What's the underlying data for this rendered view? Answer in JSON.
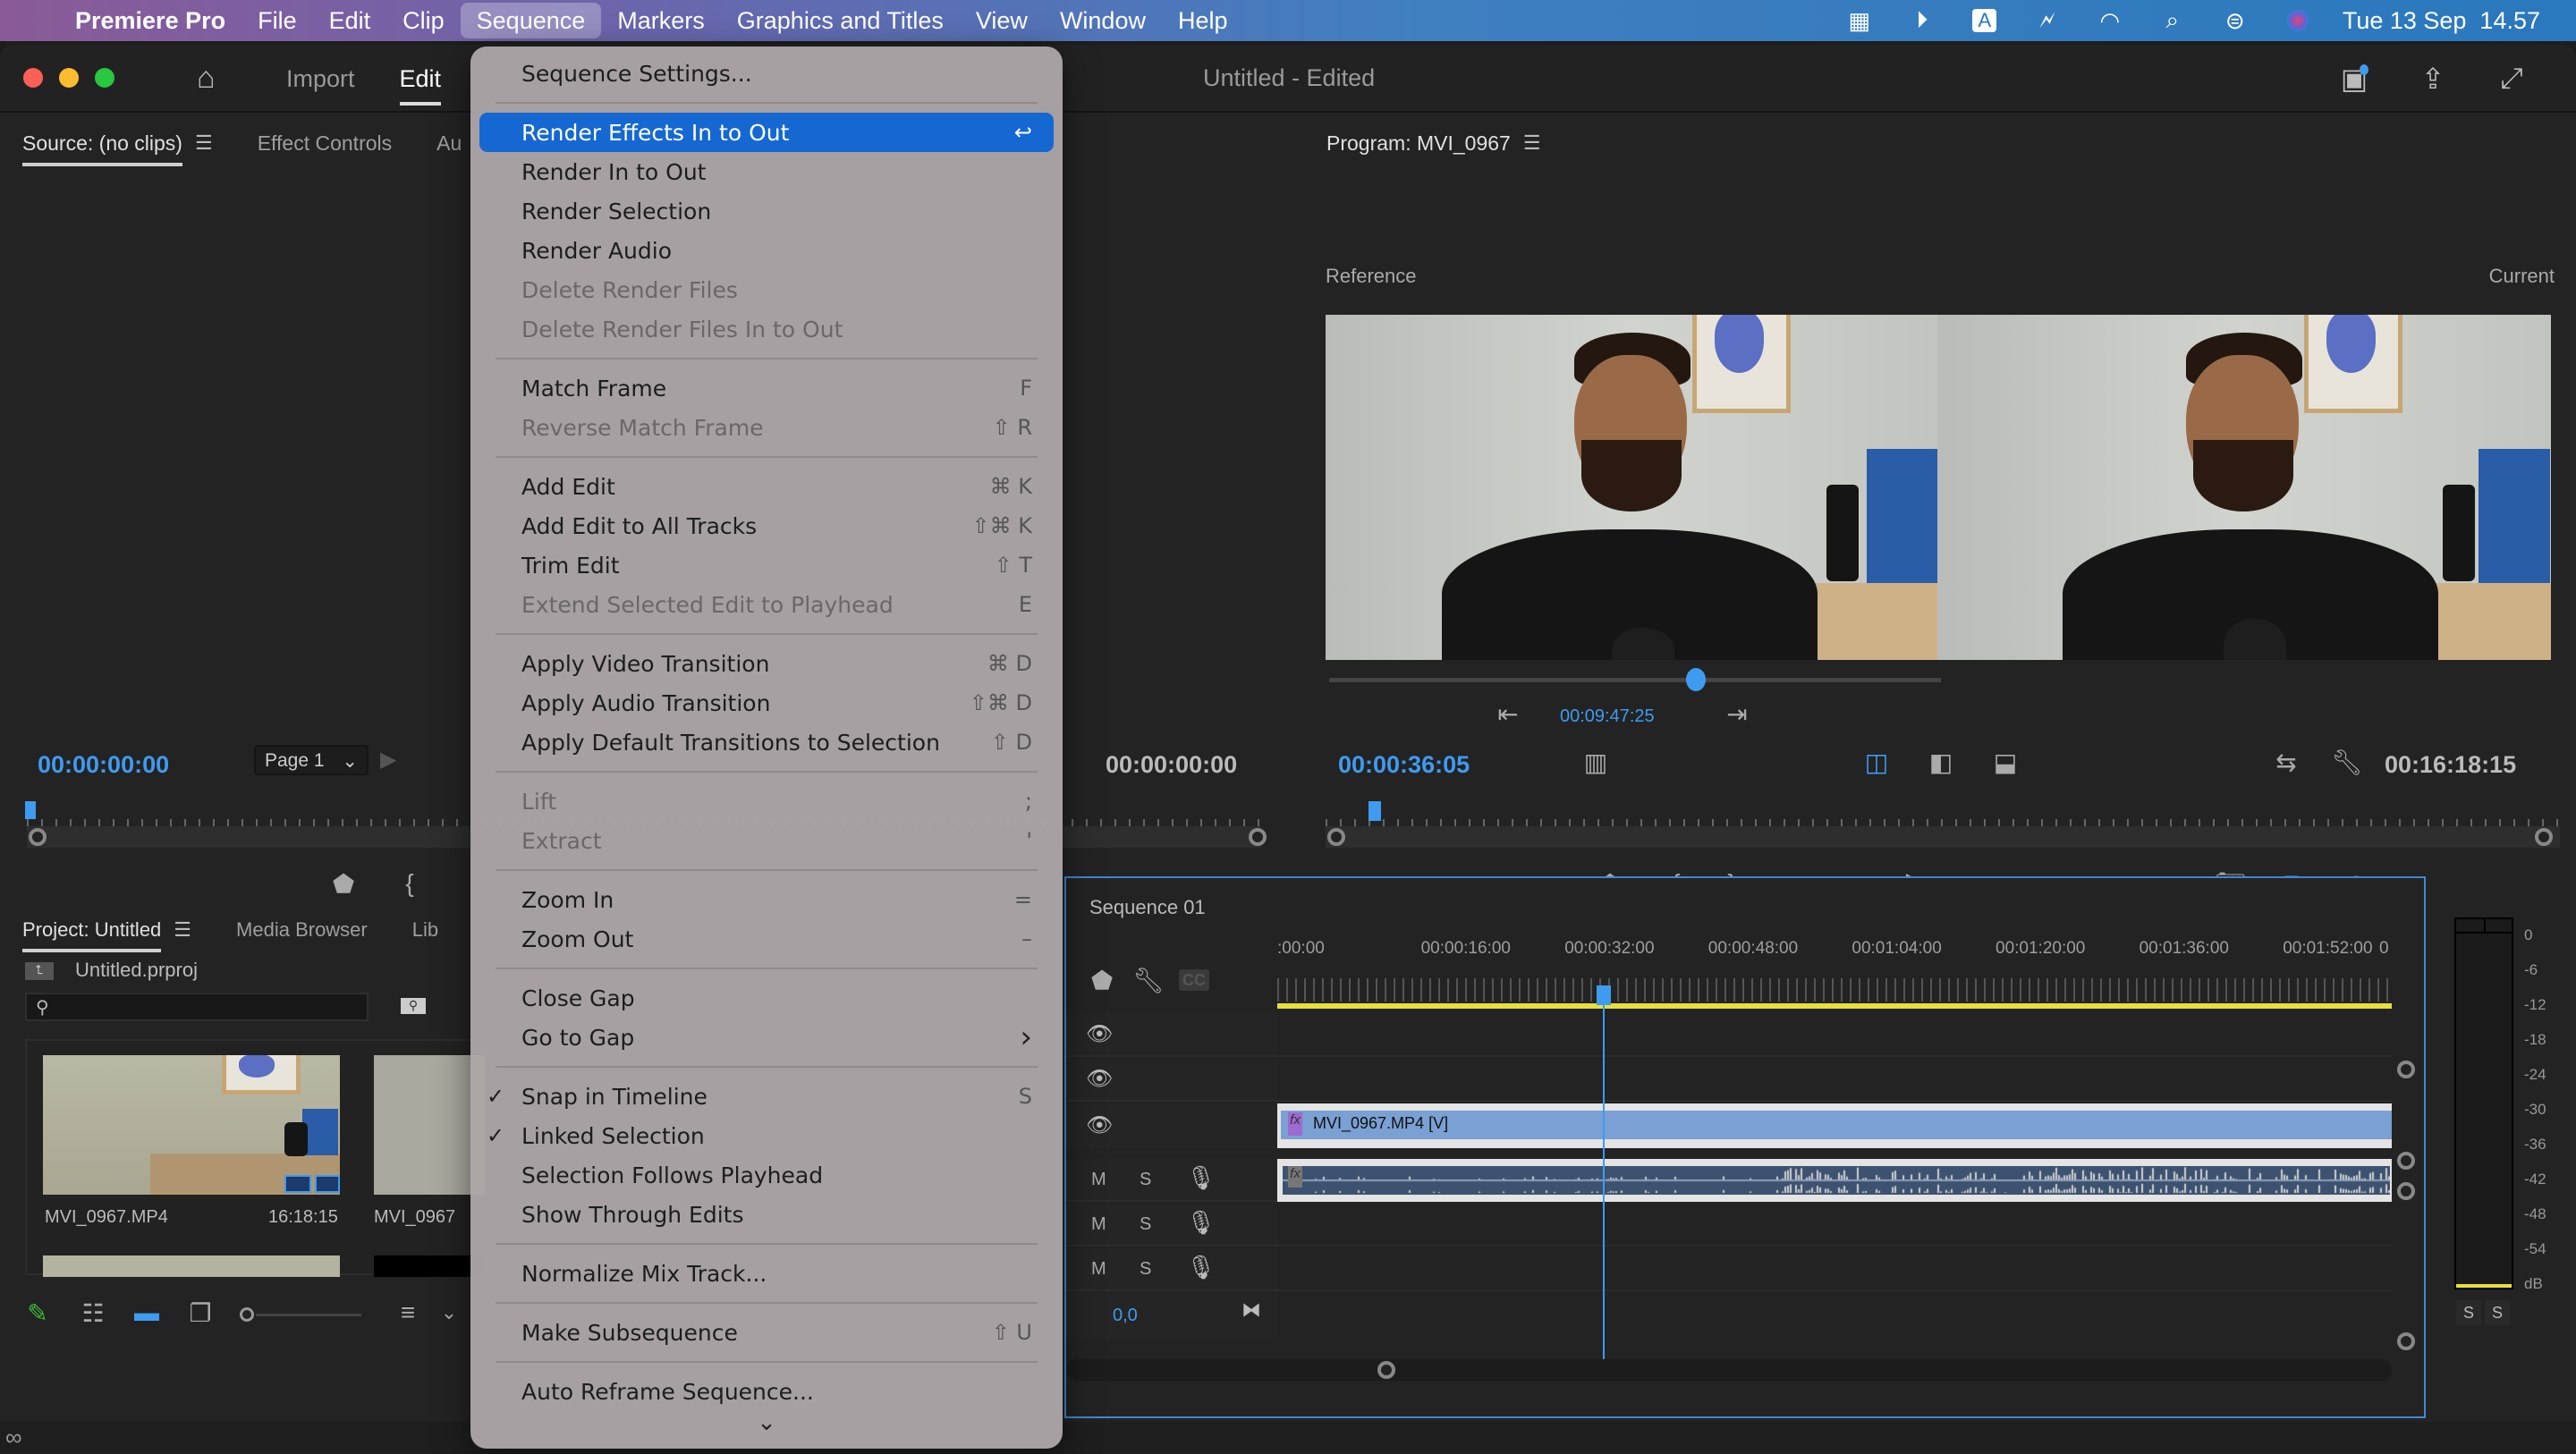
{
  "menubar": {
    "app_name": "Premiere Pro",
    "items": [
      "File",
      "Edit",
      "Clip",
      "Sequence",
      "Markers",
      "Graphics and Titles",
      "View",
      "Window",
      "Help"
    ],
    "active_item": "Sequence",
    "status": {
      "input_source": "A",
      "datetime": "Tue 13 Sep  14.57"
    }
  },
  "window": {
    "workspace_tabs": [
      "Import",
      "Edit"
    ],
    "active_workspace": "Edit",
    "title": "Untitled",
    "title_suffix": " - Edited"
  },
  "source_panel": {
    "tabs": [
      "Source: (no clips)",
      "Effect Controls",
      "Au"
    ],
    "timecode": "00:00:00:00",
    "page_select": "Page 1",
    "right_timecode": "00:00:00:00"
  },
  "program_panel": {
    "title": "Program: MVI_0967",
    "reference_label": "Reference",
    "current_label": "Current",
    "compare_timecode": "00:09:47:25",
    "compare_slider_fraction": 0.6,
    "timecode": "00:00:36:05",
    "duration": "00:16:18:15"
  },
  "project_panel": {
    "tabs": [
      "Project: Untitled",
      "Media Browser",
      "Lib"
    ],
    "project_file": "Untitled.prproj",
    "search_placeholder": "",
    "items": [
      {
        "name": "MVI_0967.MP4",
        "duration": "16:18:15"
      },
      {
        "name": "MVI_0967",
        "duration": ""
      }
    ]
  },
  "sequence_menu": {
    "groups": [
      [
        {
          "label": "Sequence Settings...",
          "shortcut": "",
          "enabled": true
        }
      ],
      [
        {
          "label": "Render Effects In to Out",
          "shortcut": "↩",
          "enabled": true,
          "highlighted": true
        },
        {
          "label": "Render In to Out",
          "shortcut": "",
          "enabled": true
        },
        {
          "label": "Render Selection",
          "shortcut": "",
          "enabled": true
        },
        {
          "label": "Render Audio",
          "shortcut": "",
          "enabled": true
        },
        {
          "label": "Delete Render Files",
          "shortcut": "",
          "enabled": false
        },
        {
          "label": "Delete Render Files In to Out",
          "shortcut": "",
          "enabled": false
        }
      ],
      [
        {
          "label": "Match Frame",
          "shortcut": "F",
          "enabled": true
        },
        {
          "label": "Reverse Match Frame",
          "shortcut": "⇧ R",
          "enabled": false
        }
      ],
      [
        {
          "label": "Add Edit",
          "shortcut": "⌘ K",
          "enabled": true
        },
        {
          "label": "Add Edit to All Tracks",
          "shortcut": "⇧⌘ K",
          "enabled": true
        },
        {
          "label": "Trim Edit",
          "shortcut": "⇧ T",
          "enabled": true
        },
        {
          "label": "Extend Selected Edit to Playhead",
          "shortcut": "E",
          "enabled": false
        }
      ],
      [
        {
          "label": "Apply Video Transition",
          "shortcut": "⌘ D",
          "enabled": true
        },
        {
          "label": "Apply Audio Transition",
          "shortcut": "⇧⌘ D",
          "enabled": true
        },
        {
          "label": "Apply Default Transitions to Selection",
          "shortcut": "⇧ D",
          "enabled": true
        }
      ],
      [
        {
          "label": "Lift",
          "shortcut": ";",
          "enabled": false
        },
        {
          "label": "Extract",
          "shortcut": "'",
          "enabled": false
        }
      ],
      [
        {
          "label": "Zoom In",
          "shortcut": "=",
          "enabled": true
        },
        {
          "label": "Zoom Out",
          "shortcut": "–",
          "enabled": true
        }
      ],
      [
        {
          "label": "Close Gap",
          "shortcut": "",
          "enabled": true
        },
        {
          "label": "Go to Gap",
          "shortcut": "›",
          "enabled": true,
          "submenu": true
        }
      ],
      [
        {
          "label": "Snap in Timeline",
          "shortcut": "S",
          "enabled": true,
          "checked": true
        },
        {
          "label": "Linked Selection",
          "shortcut": "",
          "enabled": true,
          "checked": true
        },
        {
          "label": "Selection Follows Playhead",
          "shortcut": "",
          "enabled": true
        },
        {
          "label": "Show Through Edits",
          "shortcut": "",
          "enabled": true
        }
      ],
      [
        {
          "label": "Normalize Mix Track...",
          "shortcut": "",
          "enabled": true
        }
      ],
      [
        {
          "label": "Make Subsequence",
          "shortcut": "⇧ U",
          "enabled": true
        }
      ],
      [
        {
          "label": "Auto Reframe Sequence...",
          "shortcut": "",
          "enabled": true
        }
      ]
    ],
    "more_indicator": "⌄"
  },
  "timeline": {
    "sequence_name": "Sequence 01",
    "ruler_labels": [
      ":00:00",
      "00:00:16:00",
      "00:00:32:00",
      "00:00:48:00",
      "00:01:04:00",
      "00:01:20:00",
      "00:01:36:00",
      "00:01:52:00",
      "0"
    ],
    "playhead_seconds": 36.2,
    "visible_range_seconds": [
      0,
      124
    ],
    "video_clip": {
      "label": "MVI_0967.MP4 [V]",
      "fx": "fx"
    },
    "audio_track_buttons": [
      "M",
      "S"
    ],
    "master_value": "0,0"
  },
  "audio_meter": {
    "scale": [
      "0",
      "-6",
      "-12",
      "-18",
      "-24",
      "-30",
      "-36",
      "-42",
      "-48",
      "-54",
      "dB"
    ],
    "solo_buttons": [
      "S",
      "S"
    ]
  },
  "colors": {
    "accent_blue": "#3e9bf0",
    "menu_highlight": "#1568d2",
    "clip_video": "#7aa0d4",
    "work_area": "#e8e03a"
  }
}
